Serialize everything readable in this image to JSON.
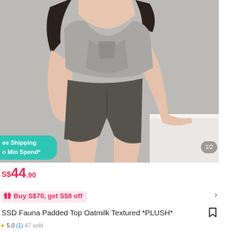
{
  "gallery": {
    "page_counter": "1/2",
    "image_label": "model wearing top and shorts"
  },
  "shipping_badge": {
    "line1": "ee Shipping",
    "line2": "o Min Spend*",
    "color": "#2dc6b4"
  },
  "price": {
    "currency": "S$",
    "integer": "44",
    "decimal": ".90",
    "color": "#e5295b"
  },
  "promo": {
    "icon": "gift-icon",
    "text": "Buy S$70, get S$8 off",
    "arrow_icon": "chevron-right-icon"
  },
  "product": {
    "title": "SSD Fauna Padded Top Oatmilk Textured *PLUSH*",
    "bookmark_icon": "bookmark-icon"
  },
  "rating": {
    "star_icon": "star-icon",
    "score": "5.0",
    "count": "(1)",
    "sold": "47 sold"
  }
}
